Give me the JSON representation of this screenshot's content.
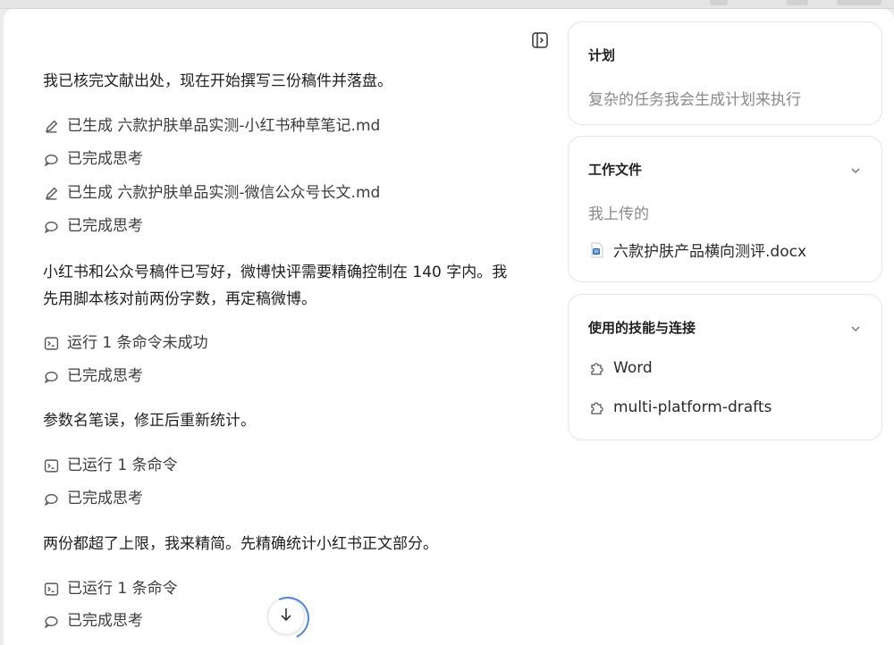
{
  "chat": {
    "intro": "我已核完文献出处，现在开始撰写三份稿件并落盘。",
    "steps_a": [
      {
        "icon": "pencil-icon",
        "label": "已生成 六款护肤单品实测-小红书种草笔记.md"
      },
      {
        "icon": "thinking-icon",
        "label": "已完成思考"
      },
      {
        "icon": "pencil-icon",
        "label": "已生成 六款护肤单品实测-微信公众号长文.md"
      },
      {
        "icon": "thinking-icon",
        "label": "已完成思考"
      }
    ],
    "msg2": "小红书和公众号稿件已写好，微博快评需要精确控制在 140 字内。我先用脚本核对前两份字数，再定稿微博。",
    "steps_b": [
      {
        "icon": "terminal-icon",
        "label": "运行 1 条命令未成功"
      },
      {
        "icon": "thinking-icon",
        "label": "已完成思考"
      }
    ],
    "msg3": "参数名笔误，修正后重新统计。",
    "steps_c": [
      {
        "icon": "terminal-icon",
        "label": "已运行 1 条命令"
      },
      {
        "icon": "thinking-icon",
        "label": "已完成思考"
      }
    ],
    "msg4": "两份都超了上限，我来精简。先精确统计小红书正文部分。",
    "steps_d": [
      {
        "icon": "terminal-icon",
        "label": "已运行 1 条命令"
      },
      {
        "icon": "thinking-icon",
        "label": "已完成思考"
      }
    ]
  },
  "panel": {
    "plan": {
      "title": "计划",
      "placeholder": "复杂的任务我会生成计划来执行"
    },
    "files": {
      "title": "工作文件",
      "section": "我上传的",
      "items": [
        {
          "icon": "word-doc-icon",
          "name": "六款护肤产品横向测评.docx"
        }
      ]
    },
    "skills": {
      "title": "使用的技能与连接",
      "items": [
        {
          "icon": "puzzle-icon",
          "name": "Word"
        },
        {
          "icon": "puzzle-icon",
          "name": "multi-platform-drafts"
        }
      ]
    }
  },
  "colors": {
    "accent": "#4b84f0",
    "text": "#1f1f1f",
    "muted": "#8a8a8a",
    "border": "#e6e6e6"
  }
}
